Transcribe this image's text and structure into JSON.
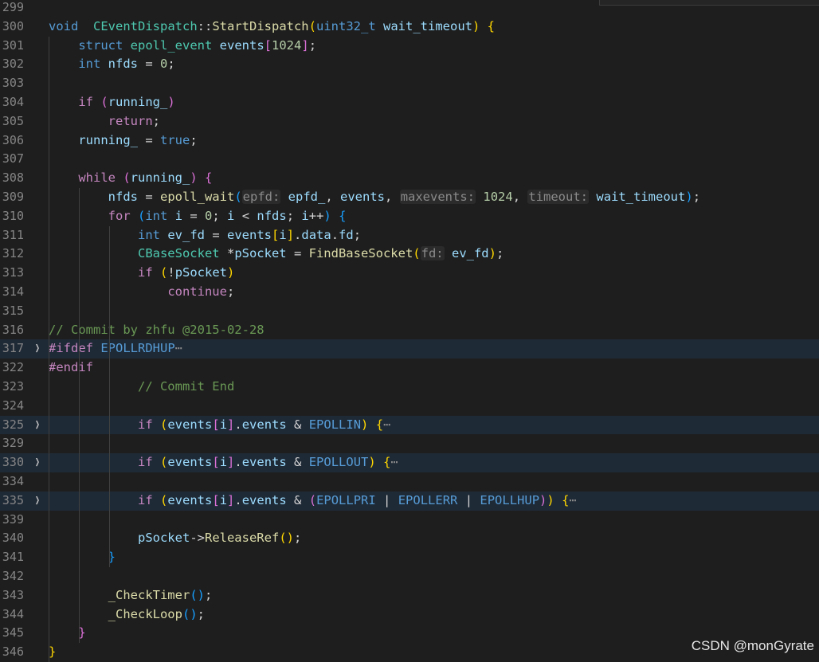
{
  "editor": {
    "lines": [
      {
        "n": "299",
        "fold": false,
        "folded": false,
        "tokens": []
      },
      {
        "n": "300",
        "fold": false,
        "folded": false,
        "tokens": [
          [
            "kw",
            "void"
          ],
          [
            "",
            "  "
          ],
          [
            "ty",
            "CEventDispatch"
          ],
          [
            "",
            "::"
          ],
          [
            "fn",
            "StartDispatch"
          ],
          [
            "b1",
            "("
          ],
          [
            "kw",
            "uint32_t"
          ],
          [
            "",
            " "
          ],
          [
            "var",
            "wait_timeout"
          ],
          [
            "b1",
            ")"
          ],
          [
            "",
            " "
          ],
          [
            "b1",
            "{"
          ]
        ]
      },
      {
        "n": "301",
        "fold": false,
        "folded": false,
        "tokens": [
          [
            "",
            "    "
          ],
          [
            "kw",
            "struct"
          ],
          [
            "",
            " "
          ],
          [
            "ty",
            "epoll_event"
          ],
          [
            "",
            " "
          ],
          [
            "var",
            "events"
          ],
          [
            "b2",
            "["
          ],
          [
            "num",
            "1024"
          ],
          [
            "b2",
            "]"
          ],
          [
            "",
            ";"
          ]
        ]
      },
      {
        "n": "302",
        "fold": false,
        "folded": false,
        "tokens": [
          [
            "",
            "    "
          ],
          [
            "kw",
            "int"
          ],
          [
            "",
            " "
          ],
          [
            "var",
            "nfds"
          ],
          [
            "",
            " = "
          ],
          [
            "num",
            "0"
          ],
          [
            "",
            ";"
          ]
        ]
      },
      {
        "n": "303",
        "fold": false,
        "folded": false,
        "tokens": []
      },
      {
        "n": "304",
        "fold": false,
        "folded": false,
        "tokens": [
          [
            "",
            "    "
          ],
          [
            "ctl",
            "if"
          ],
          [
            "",
            " "
          ],
          [
            "b2",
            "("
          ],
          [
            "var",
            "running_"
          ],
          [
            "b2",
            ")"
          ]
        ]
      },
      {
        "n": "305",
        "fold": false,
        "folded": false,
        "tokens": [
          [
            "",
            "        "
          ],
          [
            "ctl",
            "return"
          ],
          [
            "",
            ";"
          ]
        ]
      },
      {
        "n": "306",
        "fold": false,
        "folded": false,
        "tokens": [
          [
            "",
            "    "
          ],
          [
            "var",
            "running_"
          ],
          [
            "",
            " = "
          ],
          [
            "kw",
            "true"
          ],
          [
            "",
            ";"
          ]
        ]
      },
      {
        "n": "307",
        "fold": false,
        "folded": false,
        "tokens": []
      },
      {
        "n": "308",
        "fold": false,
        "folded": false,
        "tokens": [
          [
            "",
            "    "
          ],
          [
            "ctl",
            "while"
          ],
          [
            "",
            " "
          ],
          [
            "b2",
            "("
          ],
          [
            "var",
            "running_"
          ],
          [
            "b2",
            ")"
          ],
          [
            "",
            " "
          ],
          [
            "b2",
            "{"
          ]
        ]
      },
      {
        "n": "309",
        "fold": false,
        "folded": false,
        "tokens": [
          [
            "",
            "        "
          ],
          [
            "var",
            "nfds"
          ],
          [
            "",
            " = "
          ],
          [
            "fn",
            "epoll_wait"
          ],
          [
            "b3",
            "("
          ],
          [
            "hint",
            "epfd:"
          ],
          [
            "",
            " "
          ],
          [
            "var",
            "epfd_"
          ],
          [
            "",
            ", "
          ],
          [
            "var",
            "events"
          ],
          [
            "",
            ", "
          ],
          [
            "hint",
            "maxevents:"
          ],
          [
            "",
            " "
          ],
          [
            "num",
            "1024"
          ],
          [
            "",
            ", "
          ],
          [
            "hint",
            "timeout:"
          ],
          [
            "",
            " "
          ],
          [
            "var",
            "wait_timeout"
          ],
          [
            "b3",
            ")"
          ],
          [
            "",
            ";"
          ]
        ]
      },
      {
        "n": "310",
        "fold": false,
        "folded": false,
        "tokens": [
          [
            "",
            "        "
          ],
          [
            "ctl",
            "for"
          ],
          [
            "",
            " "
          ],
          [
            "b3",
            "("
          ],
          [
            "kw",
            "int"
          ],
          [
            "",
            " "
          ],
          [
            "var",
            "i"
          ],
          [
            "",
            " = "
          ],
          [
            "num",
            "0"
          ],
          [
            "",
            "; "
          ],
          [
            "var",
            "i"
          ],
          [
            "",
            " < "
          ],
          [
            "var",
            "nfds"
          ],
          [
            "",
            "; "
          ],
          [
            "var",
            "i"
          ],
          [
            "",
            "++"
          ],
          [
            "b3",
            ")"
          ],
          [
            "",
            " "
          ],
          [
            "b3",
            "{"
          ]
        ]
      },
      {
        "n": "311",
        "fold": false,
        "folded": false,
        "tokens": [
          [
            "",
            "            "
          ],
          [
            "kw",
            "int"
          ],
          [
            "",
            " "
          ],
          [
            "var",
            "ev_fd"
          ],
          [
            "",
            " = "
          ],
          [
            "var",
            "events"
          ],
          [
            "b1",
            "["
          ],
          [
            "var",
            "i"
          ],
          [
            "b1",
            "]"
          ],
          [
            "",
            "."
          ],
          [
            "var",
            "data"
          ],
          [
            "",
            "."
          ],
          [
            "var",
            "fd"
          ],
          [
            "",
            ";"
          ]
        ]
      },
      {
        "n": "312",
        "fold": false,
        "folded": false,
        "tokens": [
          [
            "",
            "            "
          ],
          [
            "ty",
            "CBaseSocket"
          ],
          [
            "",
            " *"
          ],
          [
            "var",
            "pSocket"
          ],
          [
            "",
            " = "
          ],
          [
            "fn",
            "FindBaseSocket"
          ],
          [
            "b1",
            "("
          ],
          [
            "hint",
            "fd:"
          ],
          [
            "",
            " "
          ],
          [
            "var",
            "ev_fd"
          ],
          [
            "b1",
            ")"
          ],
          [
            "",
            ";"
          ]
        ]
      },
      {
        "n": "313",
        "fold": false,
        "folded": false,
        "tokens": [
          [
            "",
            "            "
          ],
          [
            "ctl",
            "if"
          ],
          [
            "",
            " "
          ],
          [
            "b1",
            "("
          ],
          [
            "",
            "!"
          ],
          [
            "var",
            "pSocket"
          ],
          [
            "b1",
            ")"
          ]
        ]
      },
      {
        "n": "314",
        "fold": false,
        "folded": false,
        "tokens": [
          [
            "",
            "                "
          ],
          [
            "ctl",
            "continue"
          ],
          [
            "",
            ";"
          ]
        ]
      },
      {
        "n": "315",
        "fold": false,
        "folded": false,
        "tokens": []
      },
      {
        "n": "316",
        "fold": false,
        "folded": false,
        "tokens": [
          [
            "com",
            "// Commit by zhfu @2015-02-28"
          ]
        ]
      },
      {
        "n": "317",
        "fold": true,
        "folded": true,
        "tokens": [
          [
            "ctl",
            "#ifdef"
          ],
          [
            "",
            " "
          ],
          [
            "mac",
            "EPOLLRDHUP"
          ],
          [
            "ellipsis",
            "⋯"
          ]
        ]
      },
      {
        "n": "322",
        "fold": false,
        "folded": false,
        "tokens": [
          [
            "ctl",
            "#endif"
          ]
        ]
      },
      {
        "n": "323",
        "fold": false,
        "folded": false,
        "tokens": [
          [
            "",
            "            "
          ],
          [
            "com",
            "// Commit End"
          ]
        ]
      },
      {
        "n": "324",
        "fold": false,
        "folded": false,
        "tokens": []
      },
      {
        "n": "325",
        "fold": true,
        "folded": true,
        "tokens": [
          [
            "",
            "            "
          ],
          [
            "ctl",
            "if"
          ],
          [
            "",
            " "
          ],
          [
            "b1",
            "("
          ],
          [
            "var",
            "events"
          ],
          [
            "b2",
            "["
          ],
          [
            "var",
            "i"
          ],
          [
            "b2",
            "]"
          ],
          [
            "",
            "."
          ],
          [
            "var",
            "events"
          ],
          [
            "",
            " & "
          ],
          [
            "mac",
            "EPOLLIN"
          ],
          [
            "b1",
            ")"
          ],
          [
            "",
            " "
          ],
          [
            "b1",
            "{"
          ],
          [
            "ellipsis",
            "⋯"
          ]
        ]
      },
      {
        "n": "329",
        "fold": false,
        "folded": false,
        "tokens": []
      },
      {
        "n": "330",
        "fold": true,
        "folded": true,
        "tokens": [
          [
            "",
            "            "
          ],
          [
            "ctl",
            "if"
          ],
          [
            "",
            " "
          ],
          [
            "b1",
            "("
          ],
          [
            "var",
            "events"
          ],
          [
            "b2",
            "["
          ],
          [
            "var",
            "i"
          ],
          [
            "b2",
            "]"
          ],
          [
            "",
            "."
          ],
          [
            "var",
            "events"
          ],
          [
            "",
            " & "
          ],
          [
            "mac",
            "EPOLLOUT"
          ],
          [
            "b1",
            ")"
          ],
          [
            "",
            " "
          ],
          [
            "b1",
            "{"
          ],
          [
            "ellipsis",
            "⋯"
          ]
        ]
      },
      {
        "n": "334",
        "fold": false,
        "folded": false,
        "tokens": []
      },
      {
        "n": "335",
        "fold": true,
        "folded": true,
        "tokens": [
          [
            "",
            "            "
          ],
          [
            "ctl",
            "if"
          ],
          [
            "",
            " "
          ],
          [
            "b1",
            "("
          ],
          [
            "var",
            "events"
          ],
          [
            "b2",
            "["
          ],
          [
            "var",
            "i"
          ],
          [
            "b2",
            "]"
          ],
          [
            "",
            "."
          ],
          [
            "var",
            "events"
          ],
          [
            "",
            " & "
          ],
          [
            "b2",
            "("
          ],
          [
            "mac",
            "EPOLLPRI"
          ],
          [
            "",
            " | "
          ],
          [
            "mac",
            "EPOLLERR"
          ],
          [
            "",
            " | "
          ],
          [
            "mac",
            "EPOLLHUP"
          ],
          [
            "b2",
            ")"
          ],
          [
            "b1",
            ")"
          ],
          [
            "",
            " "
          ],
          [
            "b1",
            "{"
          ],
          [
            "ellipsis",
            "⋯"
          ]
        ]
      },
      {
        "n": "339",
        "fold": false,
        "folded": false,
        "tokens": []
      },
      {
        "n": "340",
        "fold": false,
        "folded": false,
        "tokens": [
          [
            "",
            "            "
          ],
          [
            "var",
            "pSocket"
          ],
          [
            "",
            "->"
          ],
          [
            "fn",
            "ReleaseRef"
          ],
          [
            "b1",
            "()"
          ],
          [
            "",
            ";"
          ]
        ]
      },
      {
        "n": "341",
        "fold": false,
        "folded": false,
        "tokens": [
          [
            "",
            "        "
          ],
          [
            "b3",
            "}"
          ]
        ]
      },
      {
        "n": "342",
        "fold": false,
        "folded": false,
        "tokens": []
      },
      {
        "n": "343",
        "fold": false,
        "folded": false,
        "tokens": [
          [
            "",
            "        "
          ],
          [
            "fn",
            "_CheckTimer"
          ],
          [
            "b3",
            "()"
          ],
          [
            "",
            ";"
          ]
        ]
      },
      {
        "n": "344",
        "fold": false,
        "folded": false,
        "tokens": [
          [
            "",
            "        "
          ],
          [
            "fn",
            "_CheckLoop"
          ],
          [
            "b3",
            "()"
          ],
          [
            "",
            ";"
          ]
        ]
      },
      {
        "n": "345",
        "fold": false,
        "folded": false,
        "tokens": [
          [
            "",
            "    "
          ],
          [
            "b2",
            "}"
          ]
        ]
      },
      {
        "n": "346",
        "fold": false,
        "folded": false,
        "tokens": [
          [
            "b1",
            "}"
          ]
        ]
      }
    ],
    "fold_icon": "chevron-right-icon",
    "colors": {
      "background": "#1e1e1e",
      "folded_line_bg": "#1f2a37",
      "keyword": "#569cd6",
      "control": "#c586c0",
      "type": "#4ec9b0",
      "function": "#dcdcaa",
      "variable": "#9cdcfe",
      "number": "#b5cea8",
      "comment": "#6a9955"
    }
  },
  "watermark": "CSDN @monGyrate"
}
